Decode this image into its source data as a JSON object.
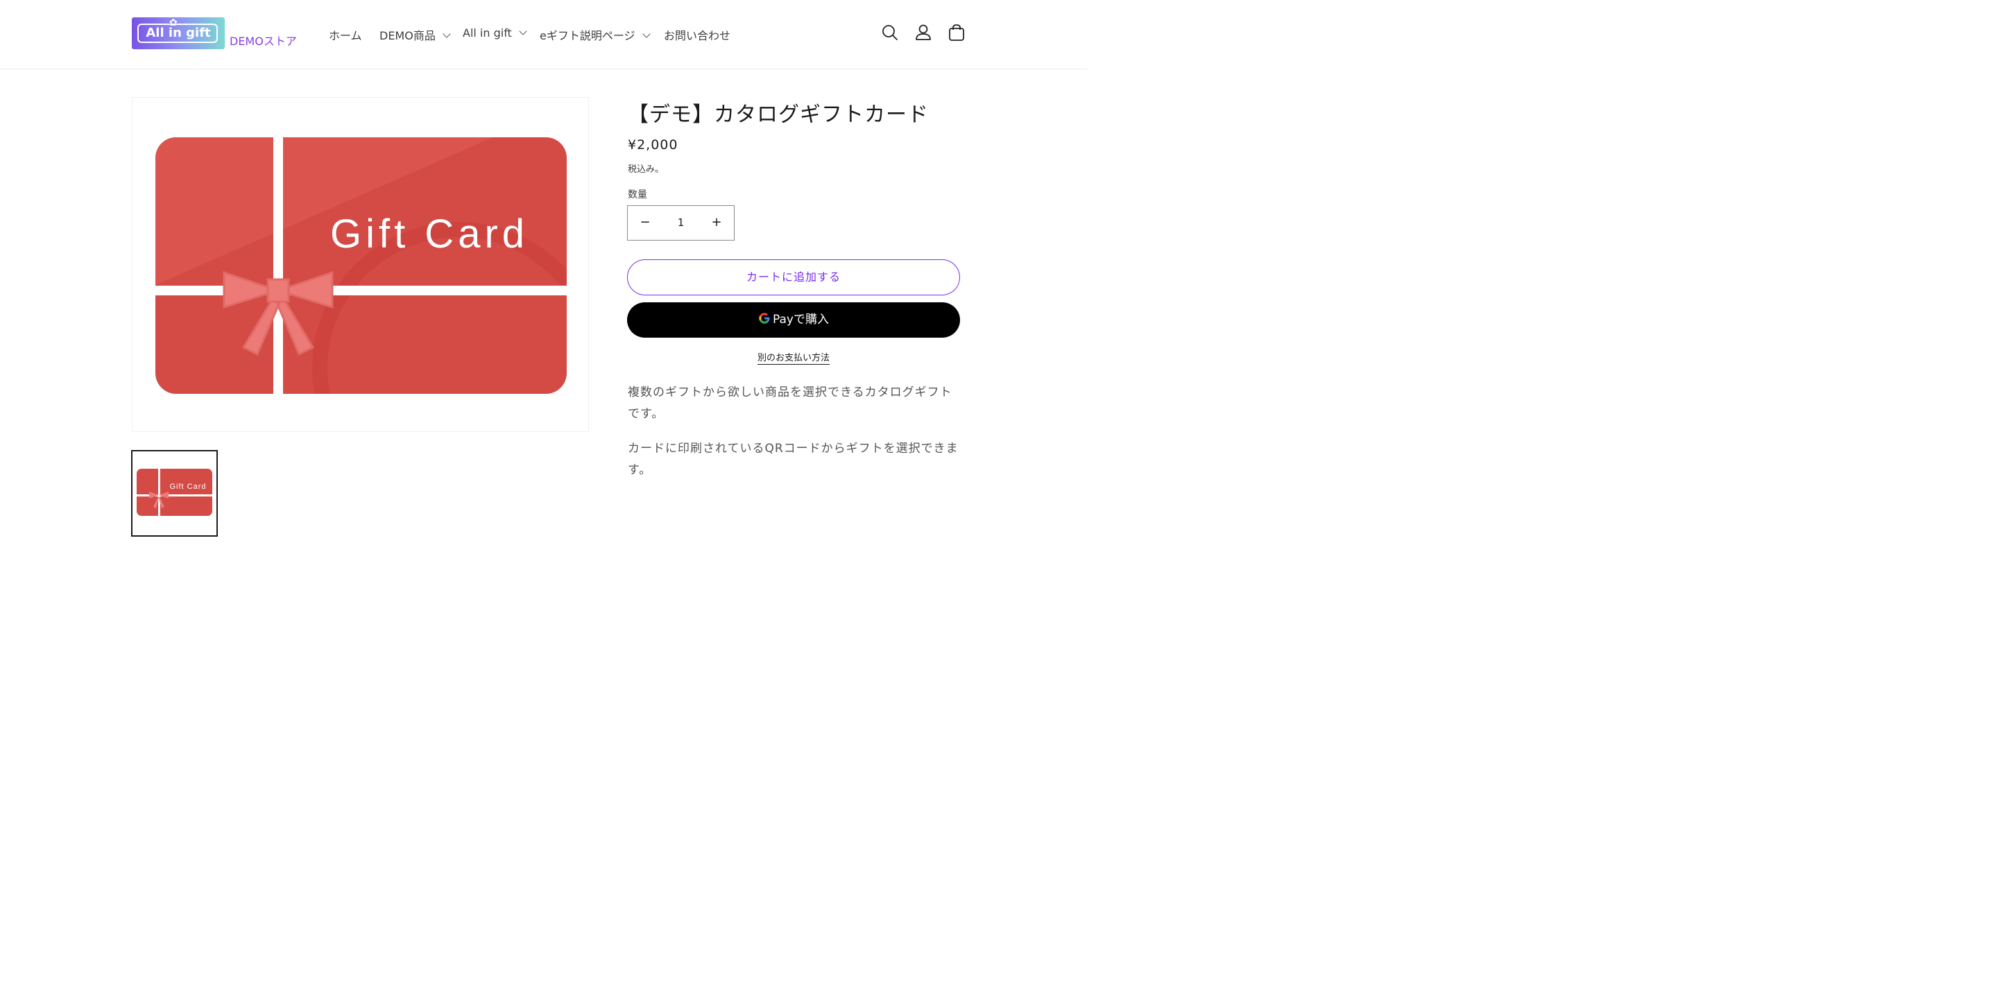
{
  "header": {
    "logo_text": "All in gift",
    "store_name": "DEMOストア",
    "nav": [
      {
        "label": "ホーム",
        "has_dropdown": false
      },
      {
        "label": "DEMO商品",
        "has_dropdown": true
      },
      {
        "label": "All in gift",
        "has_dropdown": true
      },
      {
        "label": "eギフト説明ページ",
        "has_dropdown": true
      },
      {
        "label": "お問い合わせ",
        "has_dropdown": false
      }
    ],
    "icons": [
      "search-icon",
      "account-icon",
      "cart-icon"
    ]
  },
  "gallery": {
    "main_image_text": "Gift Card",
    "thumbnail_text": "Gift Card",
    "card_color": "#d44a44"
  },
  "product": {
    "title": "【デモ】カタログギフトカード",
    "price": "¥2,000",
    "tax_note": "税込み。",
    "quantity_label": "数量",
    "quantity": "1",
    "decrement": "−",
    "increment": "+",
    "add_to_cart": "カートに追加する",
    "gpay_brand": "Pay",
    "gpay_suffix": "で購入",
    "more_payment": "別のお支払い方法",
    "description": [
      "複数のギフトから欲しい商品を選択できるカタログギフトです。",
      "カードに印刷されているQRコードからギフトを選択できます。"
    ]
  },
  "colors": {
    "accent": "#7a2cf0",
    "text": "#1a1a1a",
    "muted": "#555555"
  }
}
